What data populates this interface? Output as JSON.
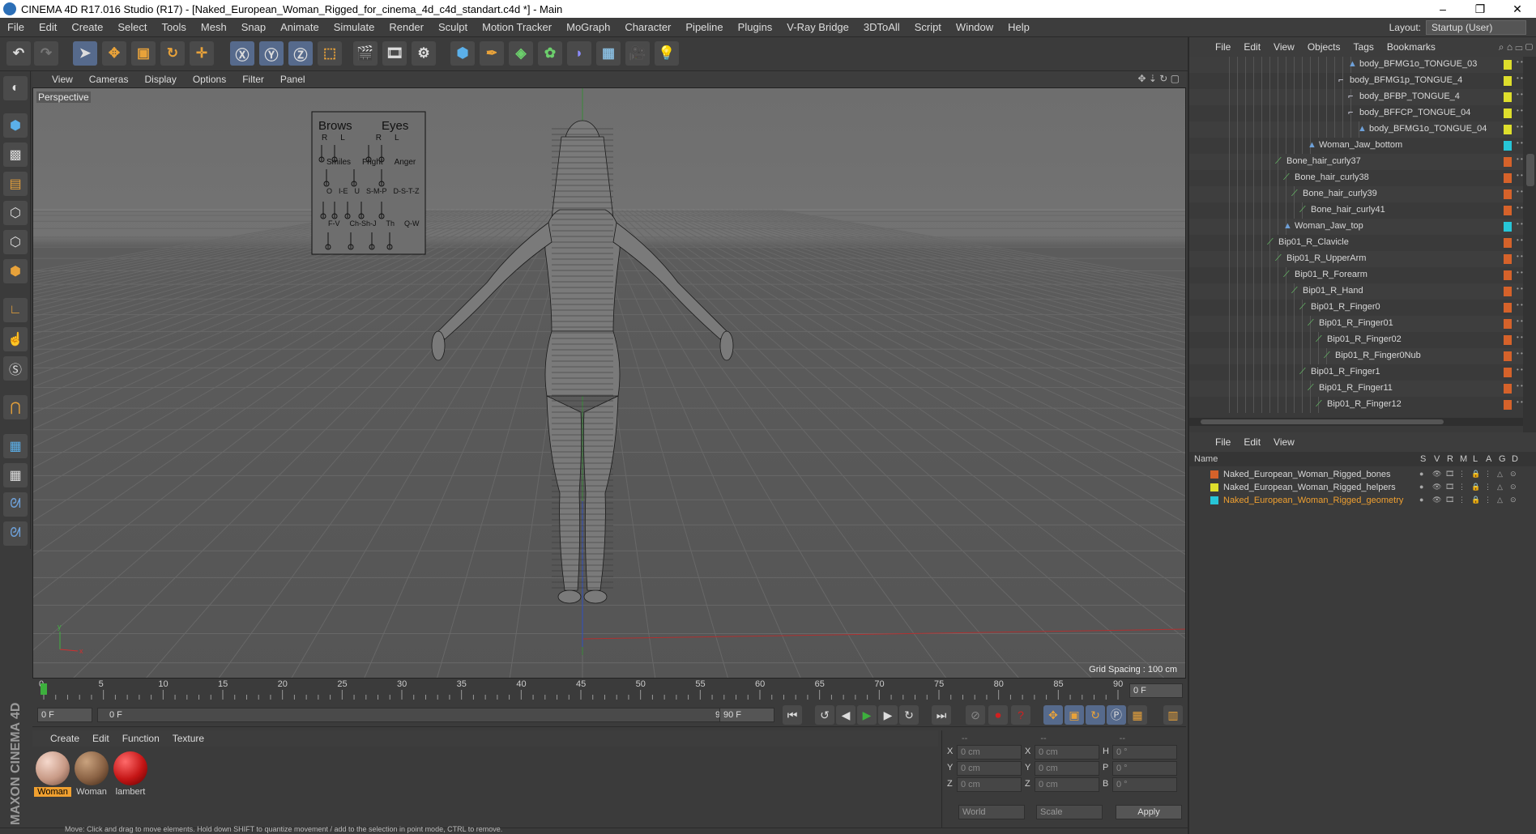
{
  "window": {
    "title": "CINEMA 4D R17.016 Studio (R17) - [Naked_European_Woman_Rigged_for_cinema_4d_c4d_standart.c4d *] - Main",
    "controls": [
      "–",
      "❐",
      "✕"
    ]
  },
  "menubar": {
    "items": [
      "File",
      "Edit",
      "Create",
      "Select",
      "Tools",
      "Mesh",
      "Snap",
      "Animate",
      "Simulate",
      "Render",
      "Sculpt",
      "Motion Tracker",
      "MoGraph",
      "Character",
      "Pipeline",
      "Plugins",
      "V-Ray Bridge",
      "3DToAll",
      "Script",
      "Window",
      "Help"
    ],
    "layout_label": "Layout:",
    "layout_value": "Startup (User)"
  },
  "viewport": {
    "menu": [
      "View",
      "Cameras",
      "Display",
      "Options",
      "Filter",
      "Panel"
    ],
    "label": "Perspective",
    "grid_spacing": "Grid Spacing : 100 cm",
    "board": {
      "title_left": "Brows",
      "title_right": "Eyes",
      "rl": [
        "R",
        "L",
        "R",
        "L"
      ],
      "row2": [
        "Smiles",
        "Fright",
        "Anger"
      ],
      "row3": [
        "O",
        "I-E",
        "U",
        "S-M-P",
        "D-S-T-Z"
      ],
      "row4": [
        "F-V",
        "Ch-Sh-J",
        "Th",
        "Q-W"
      ]
    }
  },
  "timeline": {
    "ticks": [
      "0",
      "5",
      "10",
      "15",
      "20",
      "25",
      "30",
      "35",
      "40",
      "45",
      "50",
      "55",
      "60",
      "65",
      "70",
      "75",
      "80",
      "85",
      "90"
    ],
    "end_frame": "0 F",
    "current_frame": "0 F",
    "range_start": "0 F",
    "range_end": "90 F",
    "max_frame": "90 F"
  },
  "material_manager": {
    "menu": [
      "Create",
      "Edit",
      "Function",
      "Texture"
    ],
    "materials": [
      {
        "name": "Woman",
        "color": "#c89a86"
      },
      {
        "name": "Woman",
        "color": "#8a6244"
      },
      {
        "name": "lambert",
        "color": "#c41515"
      }
    ]
  },
  "brand": "MAXON CINEMA 4D",
  "coordinates": {
    "header": [
      "--",
      "--",
      "--"
    ],
    "rows": [
      {
        "a": "X",
        "av": "0 cm",
        "b": "X",
        "bv": "0 cm",
        "c": "H",
        "cv": "0 °"
      },
      {
        "a": "Y",
        "av": "0 cm",
        "b": "Y",
        "bv": "0 cm",
        "c": "P",
        "cv": "0 °"
      },
      {
        "a": "Z",
        "av": "0 cm",
        "b": "Z",
        "bv": "0 cm",
        "c": "B",
        "cv": "0 °"
      }
    ],
    "space": "World",
    "mode": "Scale",
    "apply": "Apply"
  },
  "status": "Move: Click and drag to move elements. Hold down SHIFT to quantize movement / add to the selection in point mode, CTRL to remove.",
  "object_manager": {
    "menu": [
      "File",
      "Edit",
      "View",
      "Objects",
      "Tags",
      "Bookmarks"
    ],
    "rows": [
      {
        "name": "body_BFMG1o_TONGUE_03",
        "type": "null-tri",
        "tag": "#dede2c"
      },
      {
        "name": "body_BFMG1p_TONGUE_4",
        "type": "poly",
        "tag": "#dede2c"
      },
      {
        "name": "body_BFBP_TONGUE_4",
        "type": "poly",
        "tag": "#dede2c"
      },
      {
        "name": "body_BFFCP_TONGUE_04",
        "type": "poly",
        "tag": "#dede2c"
      },
      {
        "name": "body_BFMG1o_TONGUE_04",
        "type": "null-tri",
        "tag": "#dede2c"
      },
      {
        "name": "Woman_Jaw_bottom",
        "type": "null-tri",
        "tag": "#27c6d8"
      },
      {
        "name": "Bone_hair_curly37",
        "type": "bone",
        "tag": "#d5622a"
      },
      {
        "name": "Bone_hair_curly38",
        "type": "bone",
        "tag": "#d5622a"
      },
      {
        "name": "Bone_hair_curly39",
        "type": "bone",
        "tag": "#d5622a"
      },
      {
        "name": "Bone_hair_curly41",
        "type": "bone",
        "tag": "#d5622a"
      },
      {
        "name": "Woman_Jaw_top",
        "type": "null-tri",
        "tag": "#27c6d8"
      },
      {
        "name": "Bip01_R_Clavicle",
        "type": "bone",
        "tag": "#d5622a"
      },
      {
        "name": "Bip01_R_UpperArm",
        "type": "bone",
        "tag": "#d5622a"
      },
      {
        "name": "Bip01_R_Forearm",
        "type": "bone",
        "tag": "#d5622a"
      },
      {
        "name": "Bip01_R_Hand",
        "type": "bone",
        "tag": "#d5622a"
      },
      {
        "name": "Bip01_R_Finger0",
        "type": "bone",
        "tag": "#d5622a"
      },
      {
        "name": "Bip01_R_Finger01",
        "type": "bone",
        "tag": "#d5622a"
      },
      {
        "name": "Bip01_R_Finger02",
        "type": "bone",
        "tag": "#d5622a"
      },
      {
        "name": "Bip01_R_Finger0Nub",
        "type": "bone",
        "tag": "#d5622a"
      },
      {
        "name": "Bip01_R_Finger1",
        "type": "bone",
        "tag": "#d5622a"
      },
      {
        "name": "Bip01_R_Finger11",
        "type": "bone",
        "tag": "#d5622a"
      },
      {
        "name": "Bip01_R_Finger12",
        "type": "bone",
        "tag": "#d5622a"
      }
    ]
  },
  "layer_manager": {
    "menu": [
      "File",
      "Edit",
      "View"
    ],
    "header": {
      "name": "Name",
      "cols": [
        "S",
        "V",
        "R",
        "M",
        "L",
        "A",
        "G",
        "D"
      ]
    },
    "layers": [
      {
        "name": "Naked_European_Woman_Rigged_bones",
        "color": "#d5622a",
        "selected": false
      },
      {
        "name": "Naked_European_Woman_Rigged_helpers",
        "color": "#dede2c",
        "selected": false
      },
      {
        "name": "Naked_European_Woman_Rigged_geometry",
        "color": "#27c6d8",
        "selected": true
      }
    ]
  },
  "accent_colors": {
    "selected_text": "#f0a030",
    "x_axis": "#d03030",
    "y_axis": "#40b040",
    "z_axis": "#3060d0"
  }
}
